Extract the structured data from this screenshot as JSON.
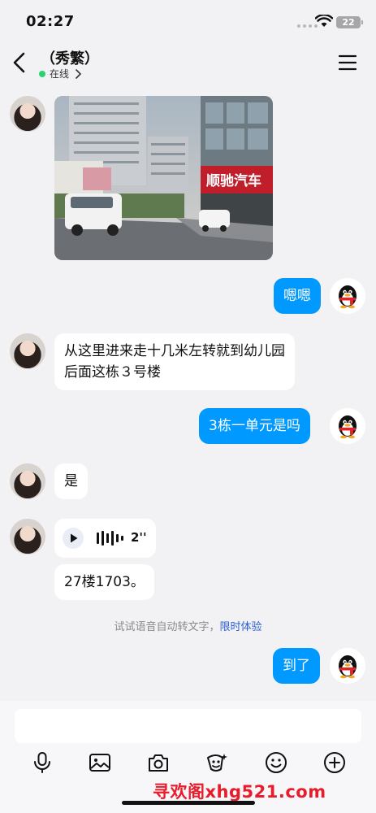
{
  "status_bar": {
    "time": "02:27",
    "battery": "22"
  },
  "header": {
    "contact_name": "（秀繁）",
    "presence": "在线"
  },
  "messages": [
    {
      "side": "in",
      "type": "image"
    },
    {
      "side": "out",
      "text": "嗯嗯"
    },
    {
      "side": "in",
      "text_line1": "从这里进来走十几米左转就到幼儿园",
      "text_line2": "后面这栋３号楼"
    },
    {
      "side": "out",
      "text": "3栋一单元是吗"
    },
    {
      "side": "in",
      "text": "是"
    },
    {
      "side": "in",
      "type": "voice",
      "duration": "2''"
    },
    {
      "side": "in",
      "text": "27楼1703。"
    },
    {
      "side": "out",
      "text": "到了"
    }
  ],
  "photo": {
    "sign_text": "顺驰汽车"
  },
  "hint": {
    "text": "试试语音自动转文字，",
    "link": "限时体验"
  },
  "toolbar": [
    "mic-icon",
    "image-icon",
    "camera-icon",
    "sticker-icon",
    "emoji-icon",
    "plus-icon"
  ],
  "watermark": "寻欢阁xhg521.com",
  "colors": {
    "out_bubble": "#0099ff",
    "online_dot": "#2bd173",
    "link": "#2d5fd6",
    "watermark": "#e81c2b"
  }
}
